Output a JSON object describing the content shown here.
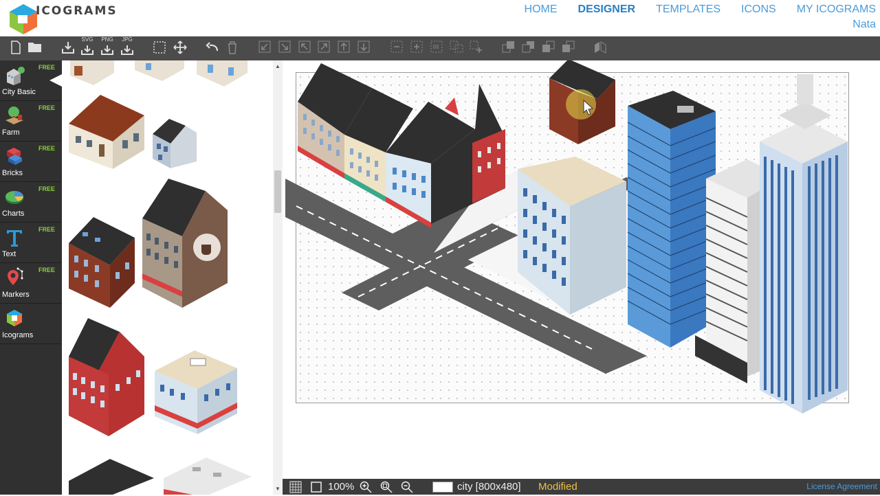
{
  "app": {
    "logo_text": "ICOGRAMS"
  },
  "nav": {
    "home": "HOME",
    "designer": "DESIGNER",
    "templates": "TEMPLATES",
    "icons": "ICONS",
    "my_icograms": "MY ICOGRAMS",
    "user": "Nata"
  },
  "toolbar": {
    "svg": "SVG",
    "png": "PNG",
    "jpg": "JPG"
  },
  "categories": [
    {
      "label": "City Basic",
      "badge": "FREE",
      "icon": "city-basic-icon"
    },
    {
      "label": "Farm",
      "badge": "FREE",
      "icon": "farm-icon"
    },
    {
      "label": "Bricks",
      "badge": "FREE",
      "icon": "bricks-icon"
    },
    {
      "label": "Charts",
      "badge": "FREE",
      "icon": "charts-icon"
    },
    {
      "label": "Text",
      "badge": "FREE",
      "icon": "text-icon"
    },
    {
      "label": "Markers",
      "badge": "FREE",
      "icon": "markers-icon"
    },
    {
      "label": "Icograms",
      "badge": "",
      "icon": "icograms-icon"
    }
  ],
  "statusbar": {
    "zoom": "100%",
    "document": "city [800x480]",
    "state": "Modified",
    "license": "License Agreement"
  },
  "colors": {
    "toolbar": "#4b4b4b",
    "sidebar": "#303030",
    "accent": "#4a9bd8",
    "free_badge": "#8cd13a",
    "modified": "#f0c040"
  }
}
